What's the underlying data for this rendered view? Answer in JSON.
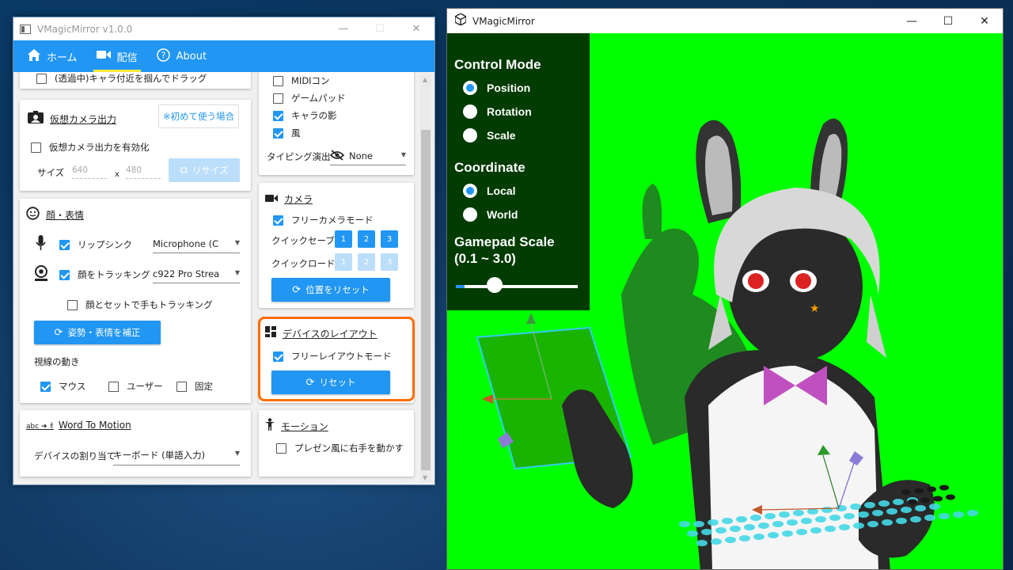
{
  "left_window": {
    "title": "VMagicMirror v1.0.0",
    "controls": [
      "—",
      "☐",
      "✕"
    ],
    "nav": [
      {
        "label": "ホーム",
        "icon": "home-icon",
        "active": false
      },
      {
        "label": "配信",
        "icon": "video-camera-icon",
        "active": true
      },
      {
        "label": "About",
        "icon": "help-icon",
        "active": false
      }
    ]
  },
  "drag_card": {
    "label": "(透過中)キャラ付近を掴んでドラッグ",
    "checked": false
  },
  "virtual_camera": {
    "title": "仮想カメラ出力",
    "help_button": "※初めて使う場合",
    "enable_label": "仮想カメラ出力を有効化",
    "size_label": "サイズ",
    "width": "640",
    "x_label": "x",
    "height": "480",
    "resize_button": "リサイズ"
  },
  "face": {
    "title": "顔・表情",
    "lipsync_label": "リップシンク",
    "mic_value": "Microphone (C",
    "face_track_label": "顔をトラッキング",
    "camera_value": "c922 Pro Strea",
    "hand_track_label": "顔とセットで手もトラッキング",
    "calibrate_button": "姿勢・表情を補正",
    "gaze_label": "視線の動き",
    "gaze_options": [
      "マウス",
      "ユーザー",
      "固定"
    ]
  },
  "word_to_motion": {
    "title": "Word To Motion",
    "assign_label": "デバイスの割り当て",
    "assign_value": "キーボード (単語入力)"
  },
  "devices": {
    "items": [
      {
        "label": "MIDIコン",
        "checked": false
      },
      {
        "label": "ゲームパッド",
        "checked": false
      },
      {
        "label": "キャラの影",
        "checked": true
      },
      {
        "label": "風",
        "checked": true
      }
    ],
    "typing_label": "タイピング演出",
    "typing_value": "None"
  },
  "camera": {
    "title": "カメラ",
    "free_camera_label": "フリーカメラモード",
    "quick_save_label": "クイックセーブ",
    "quick_load_label": "クイックロード",
    "slots": [
      "1",
      "2",
      "3"
    ],
    "reset_button": "位置をリセット"
  },
  "device_layout": {
    "title": "デバイスのレイアウト",
    "free_layout_label": "フリーレイアウトモード",
    "reset_button": "リセット"
  },
  "motion": {
    "title": "モーション",
    "presentation_label": "プレゼン風に右手を動かす"
  },
  "right_window": {
    "title": "VMagicMirror",
    "controls": [
      "—",
      "☐",
      "✕"
    ],
    "background_color": "#00ff00"
  },
  "gizmo_panel": {
    "control_mode_title": "Control Mode",
    "control_modes": [
      "Position",
      "Rotation",
      "Scale"
    ],
    "coordinate_title": "Coordinate",
    "coordinates": [
      "Local",
      "World"
    ],
    "gamepad_scale_title": "Gamepad Scale",
    "gamepad_scale_range": "(0.1 ~ 3.0)",
    "gamepad_scale_value": 0.3
  }
}
